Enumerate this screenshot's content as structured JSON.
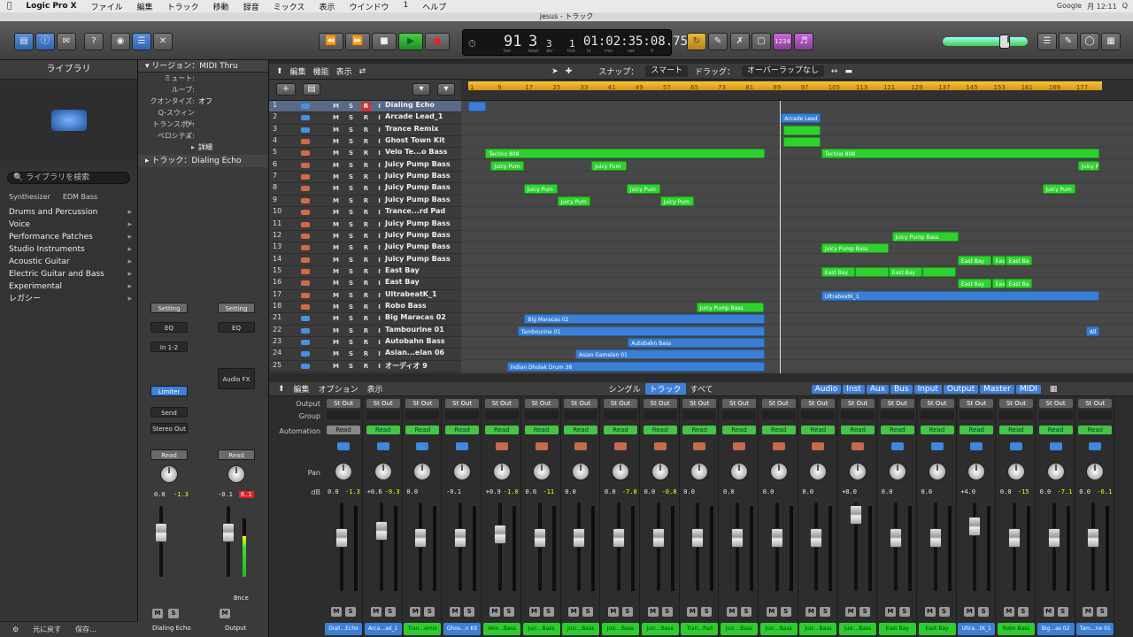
{
  "menubar": {
    "app": "Logic Pro X",
    "items": [
      "ファイル",
      "編集",
      "トラック",
      "移動",
      "録音",
      "ミックス",
      "表示",
      "ウインドウ",
      "1",
      "ヘルプ"
    ],
    "status_right": [
      "Google",
      "月 12:11",
      "Q"
    ]
  },
  "window": {
    "title": "jesus - トラック"
  },
  "toolbar": {
    "buttons": [
      "library-icon",
      "info-icon",
      "notes-icon",
      "help-icon",
      "smart-controls-icon",
      "mixer-icon",
      "editor-icon"
    ],
    "transport": [
      "rewind-icon",
      "forward-icon",
      "stop-icon",
      "play-icon",
      "record-icon"
    ],
    "lcd": {
      "bar": "91",
      "beat": "3",
      "division": "3",
      "tick": "1",
      "time": "01:02:35:08.75",
      "labels": [
        "bar",
        "beat",
        "div",
        "tick",
        "hr",
        "min",
        "sec",
        "fr"
      ]
    },
    "right_buttons": [
      "cycle-icon",
      "pencil-icon",
      "tuner-icon",
      "solo-icon",
      "count-in-label",
      "metronome-icon"
    ],
    "count_in": "1234"
  },
  "library": {
    "title": "ライブラリ",
    "search_placeholder": "ライブラリを検索",
    "breadcrumb": [
      "Synthesizer",
      "EDM Bass"
    ],
    "categories": [
      "Drums and Percussion",
      "Voice",
      "Performance Patches",
      "Studio Instruments",
      "Acoustic Guitar",
      "Electric Guitar and Bass",
      "Experimental",
      "レガシー"
    ],
    "footer": [
      "元に戻す",
      "保存..."
    ]
  },
  "inspector": {
    "region_header": "リージョン：MIDI Thru",
    "rows": [
      {
        "k": "ミュート:",
        "v": ""
      },
      {
        "k": "ループ:",
        "v": ""
      },
      {
        "k": "クオンタイズ:",
        "v": "オフ"
      },
      {
        "k": "Q-スウィング:",
        "v": ""
      },
      {
        "k": "トランスポーズ:",
        "v": ""
      },
      {
        "k": "ベロシティ:",
        "v": ""
      }
    ],
    "more": "詳細",
    "track_header": "トラック：Dialing Echo",
    "strip1": {
      "setting": "Setting",
      "eq": "EQ",
      "input": "In 1-2",
      "fx": "Limiter",
      "send": "Send",
      "output": "Stereo Out",
      "auto": "Read",
      "db_left": "0.0",
      "db_right": "-1.3",
      "name": "Dialing Echo",
      "fader": 0.62
    },
    "strip2": {
      "setting": "Setting",
      "eq": "EQ",
      "fx": "Audio FX",
      "auto": "Read",
      "db_left": "-0.1",
      "db_right": "6.1",
      "bounce": "Bnce",
      "name": "Output",
      "fader": 0.62
    }
  },
  "tracks_toolbar": {
    "menus": [
      "編集",
      "機能",
      "表示"
    ],
    "snap_label": "スナップ：",
    "snap_value": "スマート",
    "drag_label": "ドラッグ：",
    "drag_value": "オーバーラップなし"
  },
  "ruler": {
    "ticks": [
      "1",
      "9",
      "17",
      "25",
      "33",
      "41",
      "49",
      "57",
      "65",
      "73",
      "81",
      "89",
      "97",
      "105",
      "113",
      "121",
      "129",
      "137",
      "145",
      "153",
      "161",
      "169",
      "177"
    ]
  },
  "tracks": [
    {
      "num": "1",
      "name": "Dialing Echo",
      "rec": true
    },
    {
      "num": "2",
      "name": "Arcade Lead_1"
    },
    {
      "num": "3",
      "name": "Trance Remix"
    },
    {
      "num": "4",
      "name": "Ghost Town Kit"
    },
    {
      "num": "5",
      "name": "Velo Te...o Bass"
    },
    {
      "num": "6",
      "name": "Juicy Pump Bass"
    },
    {
      "num": "7",
      "name": "Juicy Pump Bass"
    },
    {
      "num": "8",
      "name": "Juicy Pump Bass"
    },
    {
      "num": "9",
      "name": "Juicy Pump Bass"
    },
    {
      "num": "10",
      "name": "Trance...rd Pad"
    },
    {
      "num": "11",
      "name": "Juicy Pump Bass"
    },
    {
      "num": "12",
      "name": "Juicy Pump Bass"
    },
    {
      "num": "13",
      "name": "Juicy Pump Bass"
    },
    {
      "num": "14",
      "name": "Juicy Pump Bass"
    },
    {
      "num": "15",
      "name": "East Bay"
    },
    {
      "num": "16",
      "name": "East Bay"
    },
    {
      "num": "17",
      "name": "UltrabeatK_1"
    },
    {
      "num": "18",
      "name": "Robo Bass"
    },
    {
      "num": "21",
      "name": "Big Maracas 02"
    },
    {
      "num": "22",
      "name": "Tambourine 01"
    },
    {
      "num": "23",
      "name": "Autobahn Bass"
    },
    {
      "num": "24",
      "name": "Asian...elan 06"
    },
    {
      "num": "25",
      "name": "オーディオ 9"
    }
  ],
  "track_buttons": [
    "M",
    "S",
    "R",
    "I"
  ],
  "regions": [
    {
      "lane": 0,
      "start": 0.01,
      "len": 0.027,
      "c": "b",
      "t": ""
    },
    {
      "lane": 1,
      "start": 0.476,
      "len": 0.059,
      "c": "b",
      "t": "Arcade Lead"
    },
    {
      "lane": 2,
      "start": 0.48,
      "len": 0.055,
      "c": "g",
      "t": ""
    },
    {
      "lane": 3,
      "start": 0.48,
      "len": 0.055,
      "c": "g",
      "t": ""
    },
    {
      "lane": 4,
      "start": 0.036,
      "len": 0.416,
      "c": "g",
      "t": "Techno 808"
    },
    {
      "lane": 4,
      "start": 0.536,
      "len": 0.414,
      "c": "g",
      "t": "Techno 808"
    },
    {
      "lane": 5,
      "start": 0.044,
      "len": 0.05,
      "c": "g",
      "t": "Juicy Pum"
    },
    {
      "lane": 5,
      "start": 0.194,
      "len": 0.052,
      "c": "g",
      "t": "Juicy Pum"
    },
    {
      "lane": 5,
      "start": 0.918,
      "len": 0.032,
      "c": "g",
      "t": "Juicy P"
    },
    {
      "lane": 7,
      "start": 0.093,
      "len": 0.05,
      "c": "g",
      "t": "Juicy Pum"
    },
    {
      "lane": 7,
      "start": 0.246,
      "len": 0.05,
      "c": "g",
      "t": "Juicy Pum"
    },
    {
      "lane": 7,
      "start": 0.865,
      "len": 0.05,
      "c": "g",
      "t": "Juicy Pum"
    },
    {
      "lane": 8,
      "start": 0.143,
      "len": 0.05,
      "c": "g",
      "t": "Juicy Pum"
    },
    {
      "lane": 8,
      "start": 0.296,
      "len": 0.05,
      "c": "g",
      "t": "Juicy Pum"
    },
    {
      "lane": 11,
      "start": 0.641,
      "len": 0.1,
      "c": "g",
      "t": "Juicy Pump Bass"
    },
    {
      "lane": 12,
      "start": 0.536,
      "len": 0.1,
      "c": "g",
      "t": "Juicy Pump Bass"
    },
    {
      "lane": 13,
      "start": 0.739,
      "len": 0.05,
      "c": "g",
      "t": "East Bay"
    },
    {
      "lane": 13,
      "start": 0.79,
      "len": 0.02,
      "c": "g",
      "t": "Eas"
    },
    {
      "lane": 13,
      "start": 0.81,
      "len": 0.04,
      "c": "g",
      "t": "East Ba"
    },
    {
      "lane": 14,
      "start": 0.536,
      "len": 0.05,
      "c": "g",
      "t": "East Bay"
    },
    {
      "lane": 14,
      "start": 0.586,
      "len": 0.05,
      "c": "g",
      "t": ""
    },
    {
      "lane": 14,
      "start": 0.636,
      "len": 0.05,
      "c": "g",
      "t": "East Bay"
    },
    {
      "lane": 14,
      "start": 0.686,
      "len": 0.05,
      "c": "g",
      "t": ""
    },
    {
      "lane": 15,
      "start": 0.739,
      "len": 0.05,
      "c": "g",
      "t": "East Bay"
    },
    {
      "lane": 15,
      "start": 0.79,
      "len": 0.02,
      "c": "g",
      "t": "Eas"
    },
    {
      "lane": 15,
      "start": 0.81,
      "len": 0.04,
      "c": "g",
      "t": "East Ba"
    },
    {
      "lane": 16,
      "start": 0.536,
      "len": 0.414,
      "c": "b",
      "t": "UltrabeatK_1"
    },
    {
      "lane": 17,
      "start": 0.35,
      "len": 0.1,
      "c": "g",
      "t": "Juicy Pump Bass"
    },
    {
      "lane": 18,
      "start": 0.094,
      "len": 0.358,
      "c": "b",
      "t": "Big Maracas 02"
    },
    {
      "lane": 19,
      "start": 0.084,
      "len": 0.368,
      "c": "b",
      "t": "Tambourine 01"
    },
    {
      "lane": 19,
      "start": 0.93,
      "len": 0.02,
      "c": "b",
      "t": "All"
    },
    {
      "lane": 20,
      "start": 0.248,
      "len": 0.204,
      "c": "b",
      "t": "Autobahn Bass"
    },
    {
      "lane": 21,
      "start": 0.17,
      "len": 0.282,
      "c": "b",
      "t": "Asian Gamelan 01"
    },
    {
      "lane": 22,
      "start": 0.068,
      "len": 0.384,
      "c": "b",
      "t": "Indian Dholak Drum 38"
    }
  ],
  "mixer_toolbar": {
    "menus": [
      "編集",
      "オプション",
      "表示"
    ],
    "views": [
      "シングル",
      "トラック",
      "すべて"
    ],
    "active_view": "トラック",
    "filters": [
      "Audio",
      "Inst",
      "Aux",
      "Bus",
      "Input",
      "Output",
      "Master",
      "MIDI"
    ]
  },
  "mixer_labels": [
    "Output",
    "Group",
    "Automation",
    "Pan",
    "dB"
  ],
  "channels": [
    {
      "out": "St Out",
      "auto": "Read",
      "name": "Diali...Echo",
      "db": "0.0",
      "db2": "-1.3",
      "c": "b",
      "fader": 0.6
    },
    {
      "out": "St Out",
      "auto": "Read",
      "name": "Arca...ad_1",
      "db": "+0.6",
      "db2": "-9.3",
      "c": "b",
      "fader": 0.68
    },
    {
      "out": "St Out",
      "auto": "Read",
      "name": "Tran...emix",
      "db": "0.0",
      "db2": "",
      "c": "g",
      "fader": 0.6
    },
    {
      "out": "St Out",
      "auto": "Read",
      "name": "Ghos...n Kit",
      "db": "-0.1",
      "db2": "",
      "c": "b",
      "fader": 0.6
    },
    {
      "out": "St Out",
      "auto": "Read",
      "name": "Velo...Bass",
      "db": "+0.9",
      "db2": "-1.0",
      "c": "g",
      "fader": 0.64
    },
    {
      "out": "St Out",
      "auto": "Read",
      "name": "Juic...Bass",
      "db": "0.0",
      "db2": "-11",
      "c": "g",
      "fader": 0.6
    },
    {
      "out": "St Out",
      "auto": "Read",
      "name": "Juic...Bass",
      "db": "0.0",
      "db2": "",
      "c": "g",
      "fader": 0.6
    },
    {
      "out": "St Out",
      "auto": "Read",
      "name": "Juic...Bass",
      "db": "0.0",
      "db2": "-7.8",
      "c": "g",
      "fader": 0.6
    },
    {
      "out": "St Out",
      "auto": "Read",
      "name": "Juic...Bass",
      "db": "0.0",
      "db2": "-0.8",
      "c": "g",
      "fader": 0.6
    },
    {
      "out": "St Out",
      "auto": "Read",
      "name": "Tran...Pad",
      "db": "0.0",
      "db2": "",
      "c": "g",
      "fader": 0.6
    },
    {
      "out": "St Out",
      "auto": "Read",
      "name": "Juic...Bass",
      "db": "0.0",
      "db2": "",
      "c": "g",
      "fader": 0.6
    },
    {
      "out": "St Out",
      "auto": "Read",
      "name": "Juic...Bass",
      "db": "0.0",
      "db2": "",
      "c": "g",
      "fader": 0.6
    },
    {
      "out": "St Out",
      "auto": "Read",
      "name": "Juic...Bass",
      "db": "0.0",
      "db2": "",
      "c": "g",
      "fader": 0.6
    },
    {
      "out": "St Out",
      "auto": "Read",
      "name": "Juic...Bass",
      "db": "+8.0",
      "db2": "",
      "c": "g",
      "fader": 0.86
    },
    {
      "out": "St Out",
      "auto": "Read",
      "name": "East Bay",
      "db": "0.0",
      "db2": "",
      "c": "g",
      "fader": 0.6
    },
    {
      "out": "St Out",
      "auto": "Read",
      "name": "East Bay",
      "db": "0.0",
      "db2": "",
      "c": "g",
      "fader": 0.6
    },
    {
      "out": "St Out",
      "auto": "Read",
      "name": "Ultra...tK_1",
      "db": "+4.0",
      "db2": "",
      "c": "b",
      "fader": 0.73
    },
    {
      "out": "St Out",
      "auto": "Read",
      "name": "Robo Bass",
      "db": "0.0",
      "db2": "-15",
      "c": "g",
      "fader": 0.6
    },
    {
      "out": "St Out",
      "auto": "Read",
      "name": "Big...as 02",
      "db": "0.0",
      "db2": "-7.1",
      "c": "b",
      "fader": 0.6
    },
    {
      "out": "St Out",
      "auto": "Read",
      "name": "Tam...ne 01",
      "db": "0.0",
      "db2": "-6.1",
      "c": "b",
      "fader": 0.6
    }
  ],
  "colors": {
    "region_green": "#2fd12f",
    "region_blue": "#3a7fd4",
    "cycle": "#f6c33d",
    "accent": "#3f7fd8"
  }
}
